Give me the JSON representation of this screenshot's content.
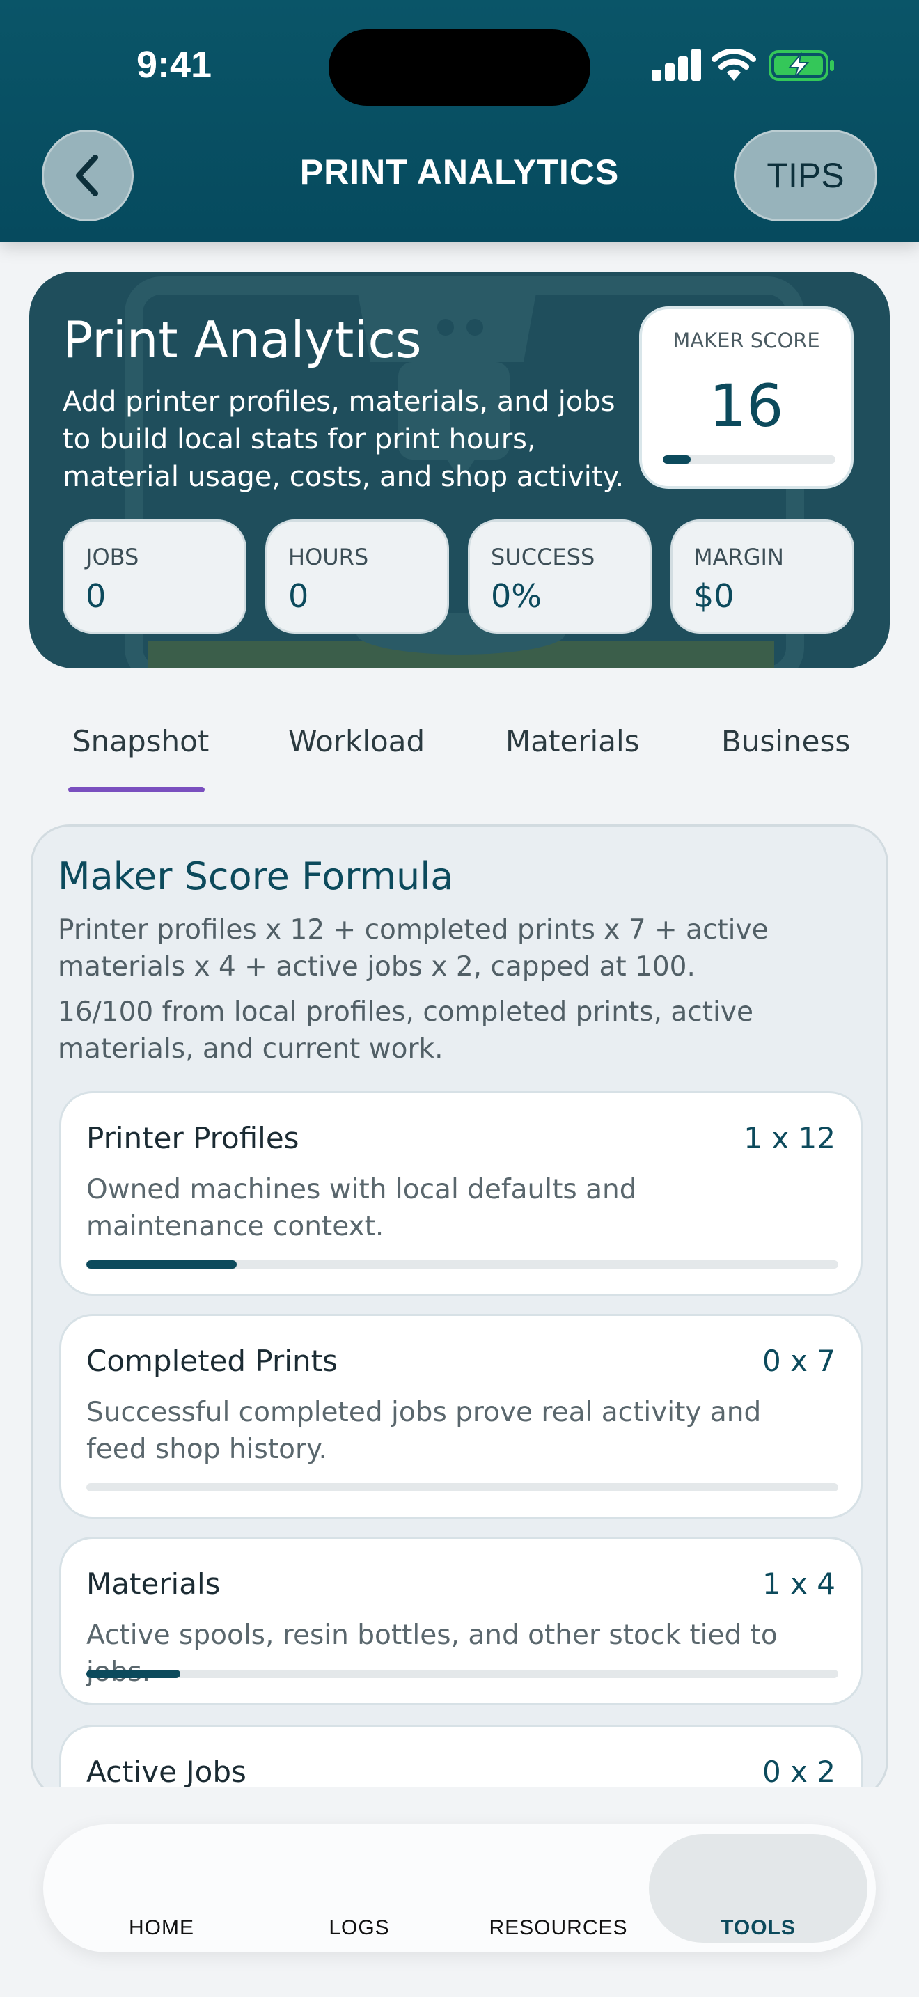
{
  "status_bar": {
    "time": "9:41"
  },
  "header": {
    "title": "PRINT ANALYTICS",
    "tips_label": "TIPS"
  },
  "hero": {
    "title": "Print Analytics",
    "description": "Add printer profiles, materials, and jobs to build local stats for print hours, material usage, costs, and shop activity.",
    "maker_score": {
      "label": "MAKER SCORE",
      "value": "16",
      "progress": 0.16
    },
    "stats": [
      {
        "label": "JOBS",
        "value": "0"
      },
      {
        "label": "HOURS",
        "value": "0"
      },
      {
        "label": "SUCCESS",
        "value": "0%"
      },
      {
        "label": "MARGIN",
        "value": "$0"
      }
    ]
  },
  "tabs": [
    "Snapshot",
    "Workload",
    "Materials",
    "Business"
  ],
  "active_tab": "Snapshot",
  "formula": {
    "title": "Maker Score Formula",
    "description": "Printer profiles x 12 + completed prints x 7 + active materials x 4 + active jobs x 2, capped at 100.",
    "summary": "16/100 from local profiles, completed prints, active materials, and current work.",
    "items": [
      {
        "name": "Printer Profiles",
        "formula": "1 x 12",
        "description": "Owned machines with local defaults and maintenance context.",
        "progress": 0.2
      },
      {
        "name": "Completed Prints",
        "formula": "0 x 7",
        "description": "Successful completed jobs prove real activity and feed shop history.",
        "progress": 0
      },
      {
        "name": "Materials",
        "formula": "1 x 4",
        "description": "Active spools, resin bottles, and other stock tied to jobs.",
        "progress": 0.125
      },
      {
        "name": "Active Jobs",
        "formula": "0 x 2",
        "description": "",
        "progress": 0
      }
    ]
  },
  "bottom_nav": {
    "items": [
      "HOME",
      "LOGS",
      "RESOURCES",
      "TOOLS"
    ],
    "active": "TOOLS"
  },
  "colors": {
    "header": "#064a5e",
    "accent": "#0c4a5c",
    "tab_indicator": "#7a4fbf",
    "battery": "#34c759"
  }
}
